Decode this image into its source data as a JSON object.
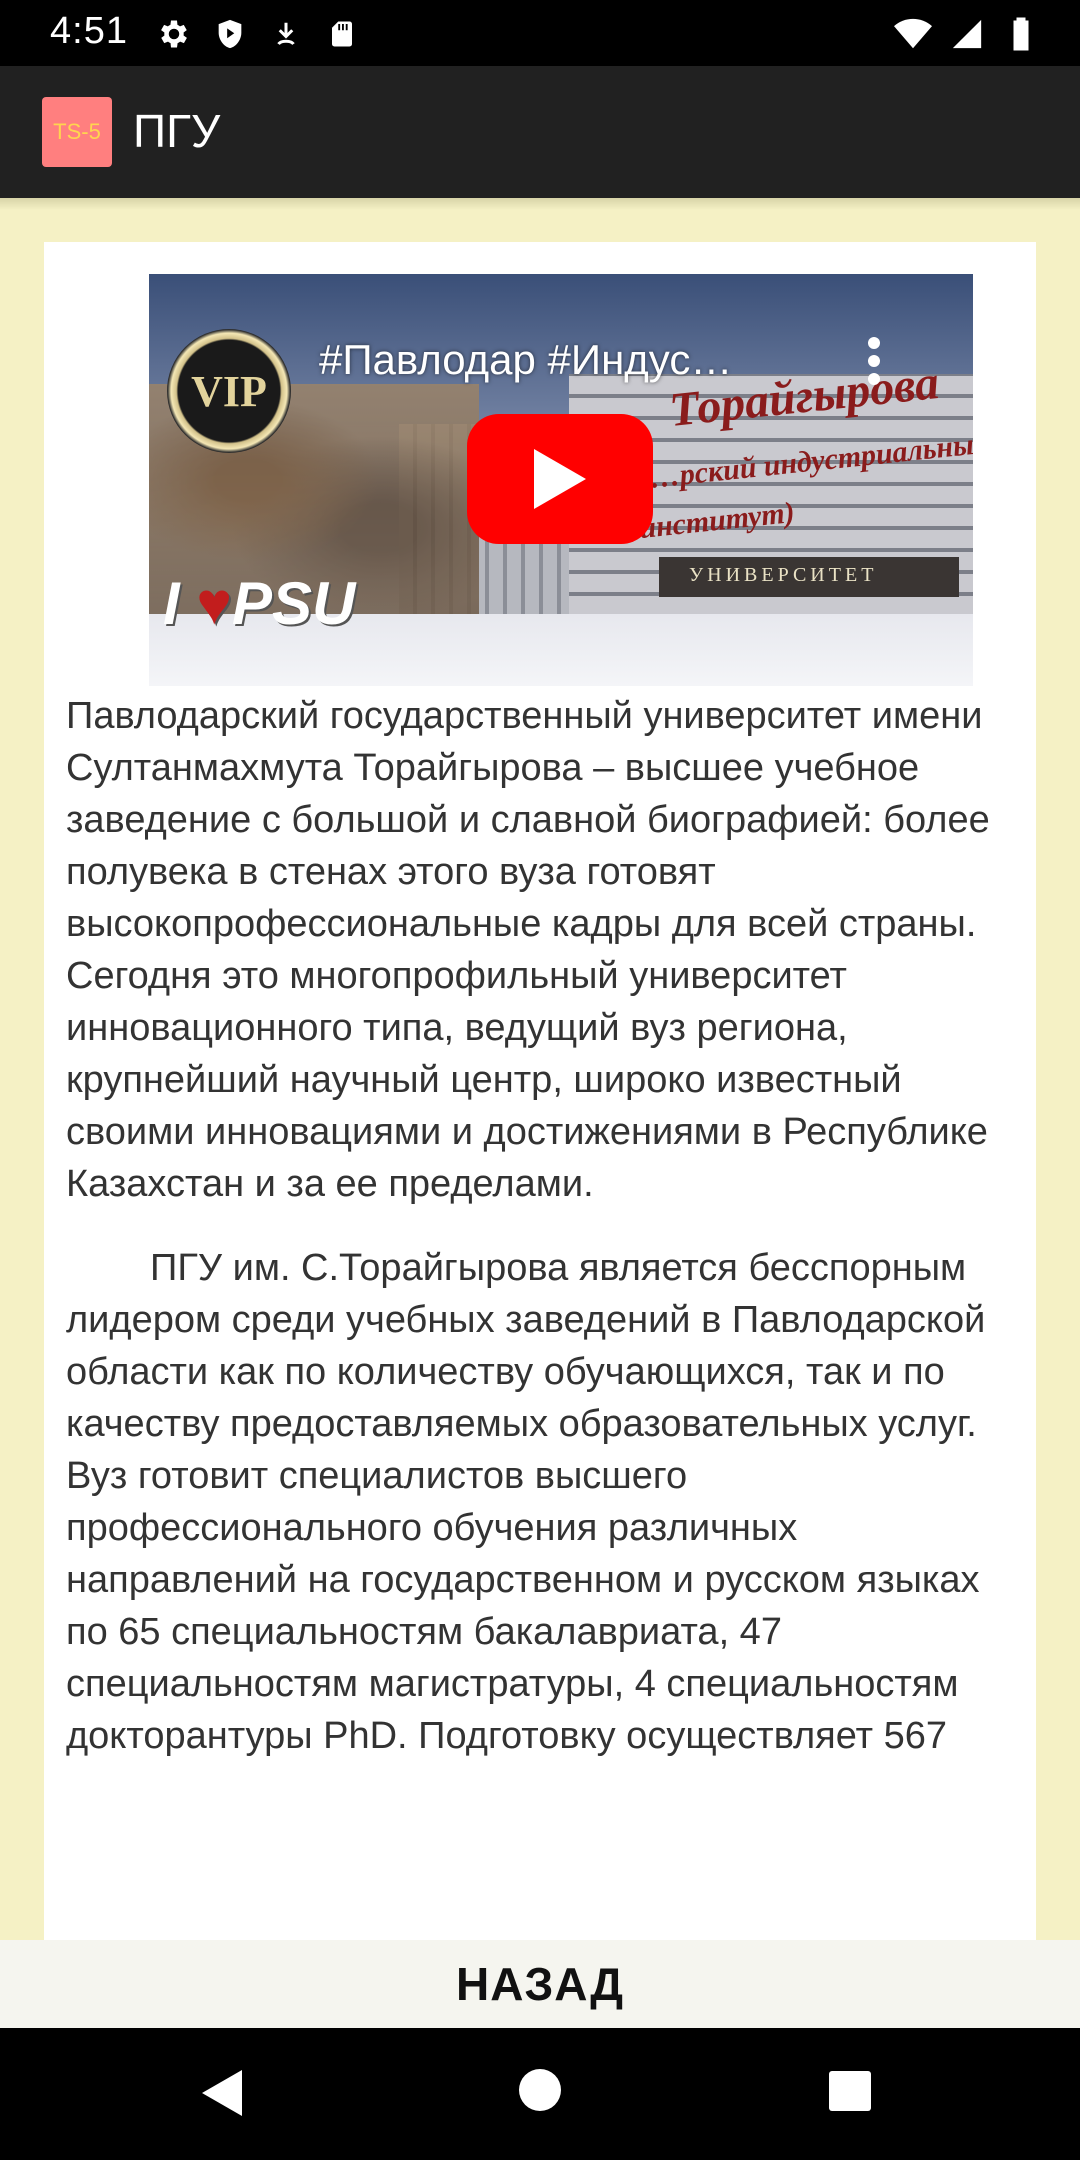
{
  "status_bar": {
    "time": "4:51",
    "left_icons": [
      "gear-icon",
      "shield-play-icon",
      "download-icon",
      "sd-card-icon"
    ],
    "right_icons": [
      "wifi-icon",
      "signal-icon",
      "battery-icon"
    ]
  },
  "app_bar": {
    "logo_text": "TS-5",
    "title": "ПГУ"
  },
  "video": {
    "title": "#Павлодар #Индус…",
    "badge_text": "VIP",
    "overlay_line1": "Торайгырова",
    "overlay_line2": "…рский индустриальный",
    "overlay_line3": "институт)",
    "sign_text": "PSU",
    "band_text": "УНИВЕРСИТЕТ"
  },
  "article": {
    "paragraph1": "Павлодарский государственный университет имени Султанмахмута Торайгырова – высшее учебное заведение с большой и славной биографией: более полувека в стенах этого вуза готовят высокопрофессиональные кадры для всей страны. Сегодня это многопрофильный университет инновационного типа, ведущий вуз региона, крупнейший научный центр, широко известный своими инновациями и достижениями в Республике Казахстан и за ее пределами.",
    "paragraph2": "ПГУ им. С.Торайгырова является бесспорным лидером среди учебных заведений в Павлодарской области как по количеству обучающихся, так и по качеству предоставляемых образовательных услуг. Вуз готовит специалистов высшего профессионального обучения различных направлений на государственном и русском языках по 65 специальностям бакалавриата, 47 специальностям магистратуры, 4 специальностям докторантуры PhD. Подготовку осуществляет 567"
  },
  "back_button": {
    "label": "НАЗАД"
  },
  "colors": {
    "app_bar": "#212121",
    "content_bg": "#f5f1c5",
    "youtube_red": "#ff0000",
    "text": "#333333"
  }
}
